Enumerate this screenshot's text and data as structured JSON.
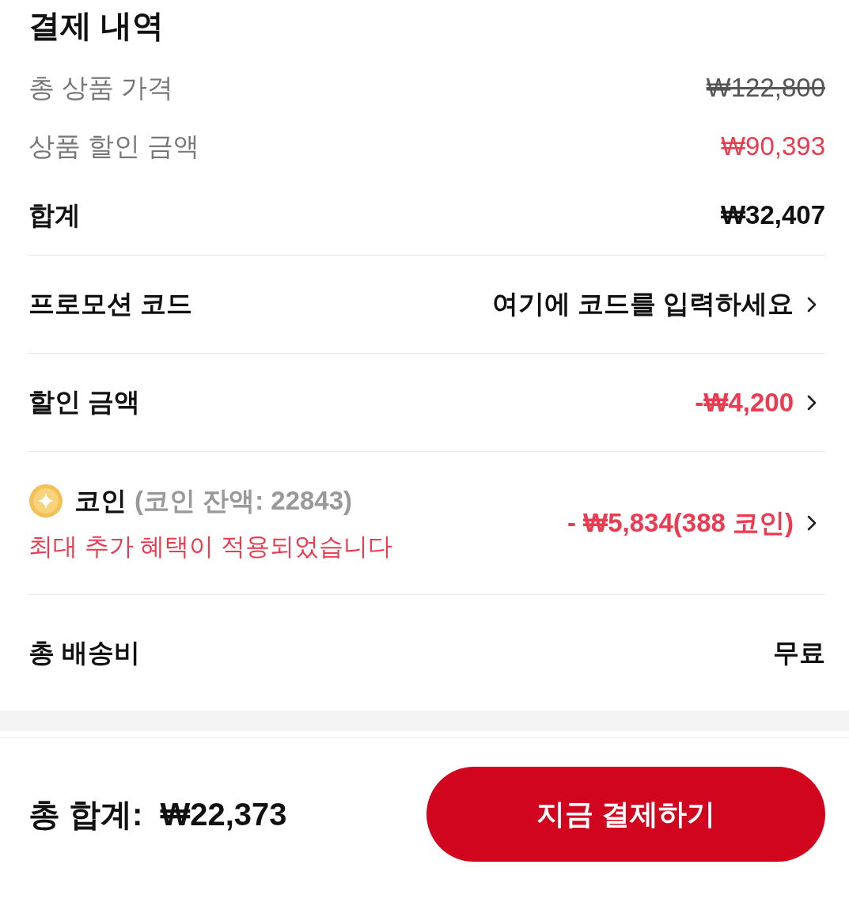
{
  "title": "결제 내역",
  "summary": [
    {
      "label": "총 상품 가격",
      "value": "₩122,800",
      "kind": "strike"
    },
    {
      "label": "상품 할인 금액",
      "value": "₩90,393",
      "kind": "discount"
    },
    {
      "label": "합계",
      "value": "₩32,407",
      "kind": "total"
    }
  ],
  "details": [
    {
      "kind": "link",
      "label": "프로모션 코드",
      "value": "여기에 코드를 입력하세요",
      "highlight": false
    },
    {
      "kind": "link",
      "label": "할인 금액",
      "value": "-₩4,200",
      "highlight": true
    },
    {
      "kind": "coin",
      "label": "코인",
      "balance": "(코인 잔액: 22843)",
      "note": "최대 추가 혜택이 적용되었습니다",
      "value": "- ₩5,834(388 코인)",
      "highlight": true
    },
    {
      "kind": "plain",
      "label": "총 배송비",
      "value": "무료",
      "highlight": false
    }
  ],
  "footer": {
    "total_label": "총 합계:",
    "total_value": "₩22,373",
    "button": "지금 결제하기"
  }
}
